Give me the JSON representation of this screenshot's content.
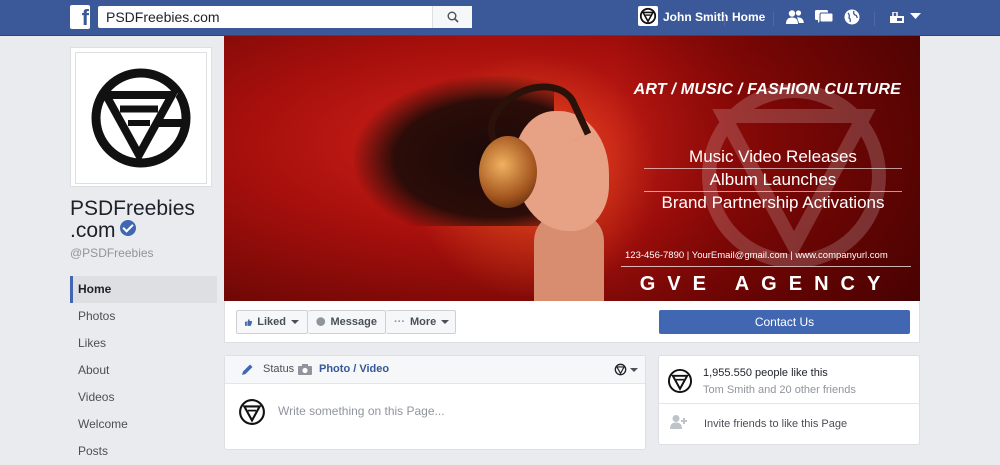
{
  "topbar": {
    "search_value": "PSDFreebies.com",
    "user_name": "John Smith",
    "home_label": "Home",
    "colors": {
      "bar": "#3b5998"
    }
  },
  "sidebar": {
    "page_name": "PSDFreebies",
    "page_name_2": ".com",
    "handle": "@PSDFreebies",
    "items": [
      {
        "label": "Home",
        "active": true
      },
      {
        "label": "Photos"
      },
      {
        "label": "Likes"
      },
      {
        "label": "About"
      },
      {
        "label": "Videos"
      },
      {
        "label": "Welcome"
      },
      {
        "label": "Posts"
      }
    ]
  },
  "cover": {
    "headline": "ART / MUSIC / FASHION CULTURE",
    "services": [
      "Music Video Releases",
      "Album Launches",
      "Brand Partnership Activations"
    ],
    "contact": "123-456-7890 | YourEmail@gmail.com | www.companyurl.com",
    "agency": "GVE AGENCY"
  },
  "actions": {
    "liked": "Liked",
    "message": "Message",
    "more": "More",
    "contact_us": "Contact Us"
  },
  "composer": {
    "status_tab": "Status",
    "photo_tab": "Photo / Video",
    "placeholder": "Write something on this Page..."
  },
  "likes_box": {
    "count": "1,955.550 people like this",
    "friends": "Tom Smith and 20 other friends",
    "invite": "Invite friends to like this Page"
  }
}
